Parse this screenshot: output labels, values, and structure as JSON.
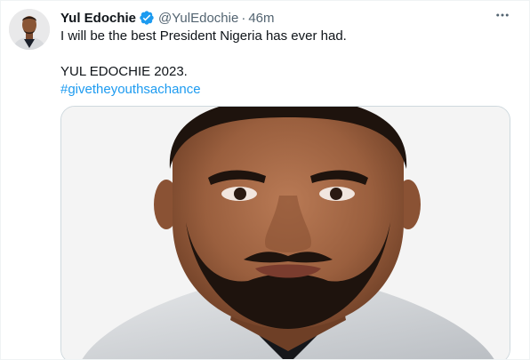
{
  "tweet": {
    "author": {
      "display_name": "Yul Edochie",
      "handle": "@YulEdochie",
      "verified": true,
      "avatar_icon": "profile-photo"
    },
    "separator": "·",
    "timestamp": "46m",
    "more_icon": "more-horizontal-icon",
    "text_lines": [
      "I will be the best President Nigeria has ever had.",
      "",
      "YUL EDOCHIE 2023."
    ],
    "hashtag": "#givetheyouthsachance",
    "media": {
      "type": "photo",
      "subject": "portrait-photo"
    }
  },
  "colors": {
    "text_primary": "#0f1419",
    "text_secondary": "#536471",
    "link": "#1d9bf0",
    "verified_badge": "#1d9bf0",
    "border": "#cfd9de"
  }
}
